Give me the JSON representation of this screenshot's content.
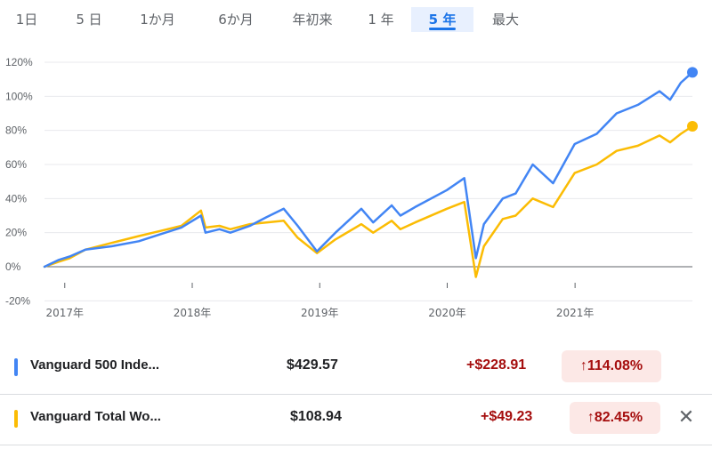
{
  "tabs": [
    "1日",
    "5 日",
    "1か月",
    "6か月",
    "年初来",
    "1 年",
    "5 年",
    "最大"
  ],
  "active_tab": "5 年",
  "chart_data": {
    "type": "line",
    "y_unit": "%",
    "ylim": [
      -20,
      120
    ],
    "yticks": [
      "120%",
      "100%",
      "80%",
      "60%",
      "40%",
      "20%",
      "0%",
      "-20%"
    ],
    "xticks": [
      "2017年",
      "2018年",
      "2019年",
      "2020年",
      "2021年"
    ],
    "series": [
      {
        "name": "Vanguard 500 Inde...",
        "color": "#4285f4",
        "points": [
          [
            "2016-11-04",
            0
          ],
          [
            "2016-12-15",
            4
          ],
          [
            "2017-01-15",
            6
          ],
          [
            "2017-03-01",
            10
          ],
          [
            "2017-05-15",
            12
          ],
          [
            "2017-08-01",
            15
          ],
          [
            "2017-10-01",
            19
          ],
          [
            "2017-12-01",
            23
          ],
          [
            "2018-01-26",
            30
          ],
          [
            "2018-02-08",
            20
          ],
          [
            "2018-03-20",
            22
          ],
          [
            "2018-04-20",
            20
          ],
          [
            "2018-06-15",
            24
          ],
          [
            "2018-08-01",
            29
          ],
          [
            "2018-09-20",
            34
          ],
          [
            "2018-10-30",
            24
          ],
          [
            "2018-12-24",
            9
          ],
          [
            "2019-02-15",
            20
          ],
          [
            "2019-04-30",
            34
          ],
          [
            "2019-06-03",
            26
          ],
          [
            "2019-07-26",
            36
          ],
          [
            "2019-08-20",
            30
          ],
          [
            "2019-10-01",
            35
          ],
          [
            "2019-12-31",
            45
          ],
          [
            "2020-02-19",
            52
          ],
          [
            "2020-03-23",
            5
          ],
          [
            "2020-04-15",
            25
          ],
          [
            "2020-06-08",
            40
          ],
          [
            "2020-07-15",
            43
          ],
          [
            "2020-09-02",
            60
          ],
          [
            "2020-10-30",
            49
          ],
          [
            "2020-12-31",
            72
          ],
          [
            "2021-03-04",
            78
          ],
          [
            "2021-04-30",
            90
          ],
          [
            "2021-06-30",
            95
          ],
          [
            "2021-08-31",
            103
          ],
          [
            "2021-09-30",
            98
          ],
          [
            "2021-10-31",
            108
          ],
          [
            "2021-12-03",
            114.08
          ]
        ]
      },
      {
        "name": "Vanguard Total Wo...",
        "color": "#fbbc04",
        "points": [
          [
            "2016-11-04",
            0
          ],
          [
            "2016-12-15",
            3
          ],
          [
            "2017-01-15",
            5
          ],
          [
            "2017-03-01",
            10
          ],
          [
            "2017-05-15",
            14
          ],
          [
            "2017-08-01",
            18
          ],
          [
            "2017-10-01",
            21
          ],
          [
            "2017-12-01",
            24
          ],
          [
            "2018-01-26",
            33
          ],
          [
            "2018-02-08",
            23
          ],
          [
            "2018-03-20",
            24
          ],
          [
            "2018-04-20",
            22
          ],
          [
            "2018-06-15",
            25
          ],
          [
            "2018-08-01",
            26
          ],
          [
            "2018-09-20",
            27
          ],
          [
            "2018-10-30",
            17
          ],
          [
            "2018-12-24",
            8
          ],
          [
            "2019-02-15",
            16
          ],
          [
            "2019-04-30",
            25
          ],
          [
            "2019-06-03",
            20
          ],
          [
            "2019-07-26",
            27
          ],
          [
            "2019-08-20",
            22
          ],
          [
            "2019-10-01",
            26
          ],
          [
            "2019-12-31",
            34
          ],
          [
            "2020-02-19",
            38
          ],
          [
            "2020-03-23",
            -6
          ],
          [
            "2020-04-15",
            12
          ],
          [
            "2020-06-08",
            28
          ],
          [
            "2020-07-15",
            30
          ],
          [
            "2020-09-02",
            40
          ],
          [
            "2020-10-30",
            35
          ],
          [
            "2020-12-31",
            55
          ],
          [
            "2021-03-04",
            60
          ],
          [
            "2021-04-30",
            68
          ],
          [
            "2021-06-30",
            71
          ],
          [
            "2021-08-31",
            77
          ],
          [
            "2021-09-30",
            73
          ],
          [
            "2021-10-31",
            78
          ],
          [
            "2021-12-03",
            82.45
          ]
        ]
      }
    ]
  },
  "holdings": [
    {
      "name": "Vanguard 500 Inde...",
      "price": "$429.57",
      "change": "+$228.91",
      "percent": "114.08%",
      "arrow": "↑",
      "color": "#4285f4"
    },
    {
      "name": "Vanguard Total Wo...",
      "price": "$108.94",
      "change": "+$49.23",
      "percent": "82.45%",
      "arrow": "↑",
      "color": "#fbbc04"
    }
  ],
  "close_symbol": "✕"
}
